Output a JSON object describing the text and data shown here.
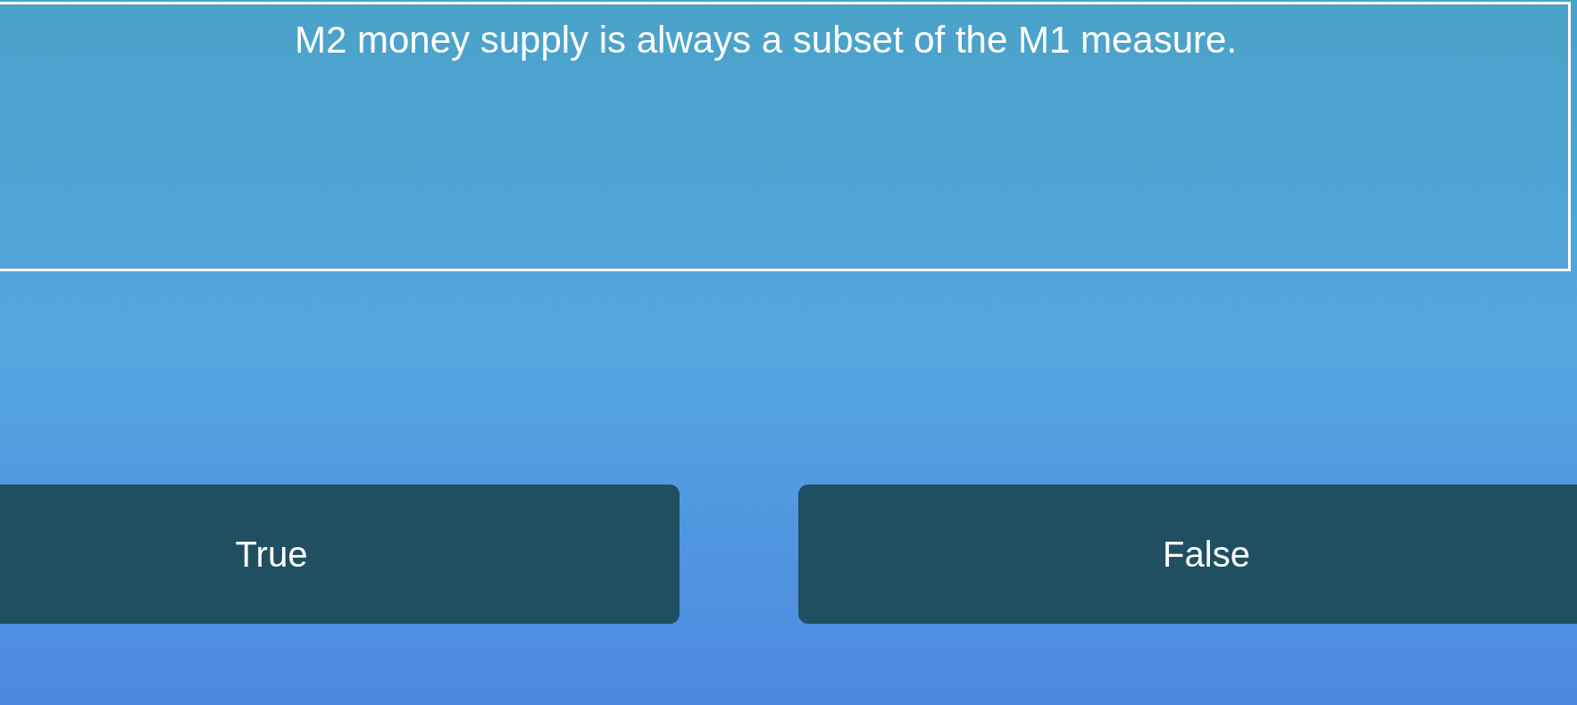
{
  "question": "M2 money supply is always a subset of the M1 measure.",
  "answers": [
    {
      "label": "True"
    },
    {
      "label": "False"
    }
  ]
}
